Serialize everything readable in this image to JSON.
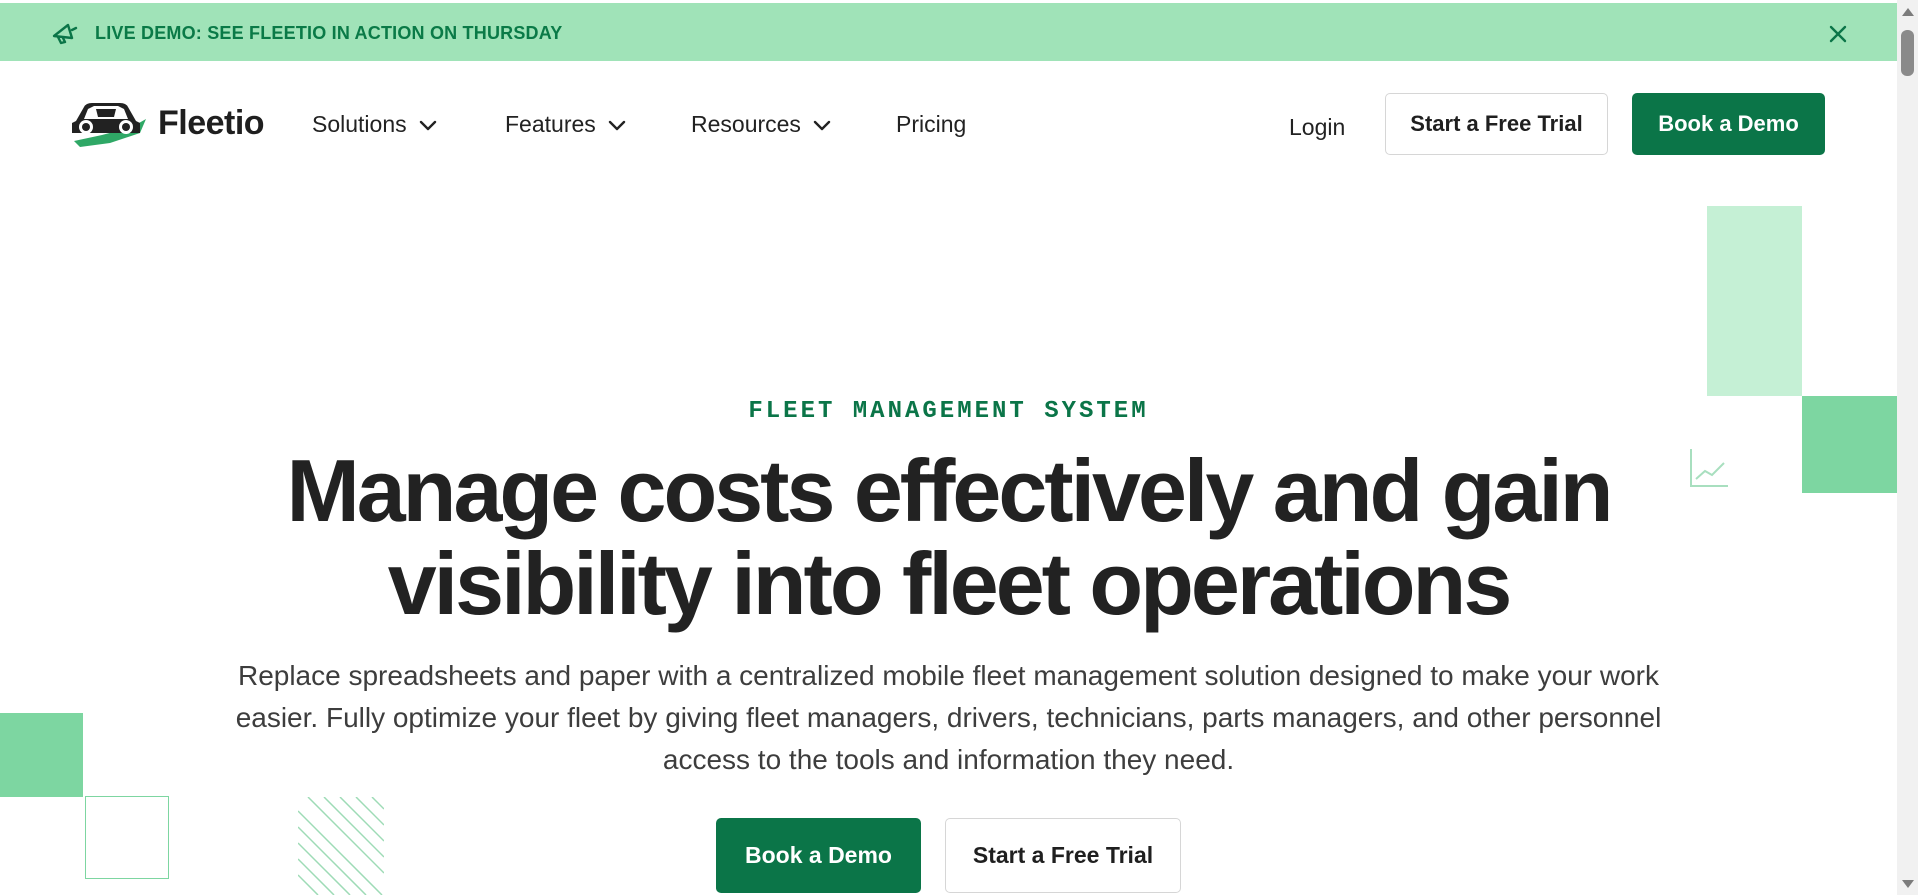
{
  "banner": {
    "text": "LIVE DEMO: SEE FLEETIO IN ACTION ON THURSDAY",
    "icon": "megaphone-icon",
    "close_icon": "close-icon"
  },
  "header": {
    "logo_text": "Fleetio",
    "nav": [
      {
        "label": "Solutions",
        "has_dropdown": true
      },
      {
        "label": "Features",
        "has_dropdown": true
      },
      {
        "label": "Resources",
        "has_dropdown": true
      },
      {
        "label": "Pricing",
        "has_dropdown": false
      }
    ],
    "login_label": "Login",
    "trial_label": "Start a Free Trial",
    "demo_label": "Book a Demo"
  },
  "hero": {
    "eyebrow": "FLEET MANAGEMENT SYSTEM",
    "headline_line1": "Manage costs effectively and gain",
    "headline_line2": "visibility into fleet operations",
    "subtext": "Replace spreadsheets and paper with a centralized mobile fleet management solution designed to make your work easier. Fully optimize your fleet by giving fleet managers, drivers, technicians, parts managers, and other personnel access to the tools and information they need.",
    "primary_cta": "Book a Demo",
    "secondary_cta": "Start a Free Trial"
  },
  "colors": {
    "brand_green": "#0b7548",
    "banner_bg": "#a0e3b8",
    "deco_light": "#c5f0d5",
    "deco_mid": "#7dd6a1"
  }
}
